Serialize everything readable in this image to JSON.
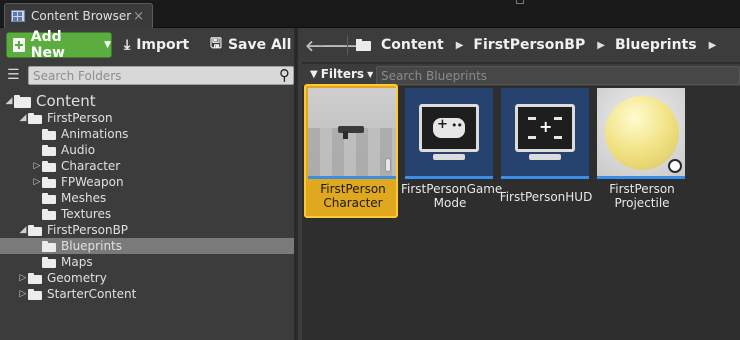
{
  "window": {
    "tab_title": "Content Browser",
    "tab_close": "×"
  },
  "toolbar": {
    "add_new_label": "Add New",
    "import_label": "Import",
    "save_all_label": "Save All"
  },
  "folder_search": {
    "placeholder": "Search Folders"
  },
  "tree": {
    "items": [
      {
        "label": "Content",
        "level": 0,
        "arrow": "◢",
        "selected": false
      },
      {
        "label": "FirstPerson",
        "level": 1,
        "arrow": "◢",
        "selected": false
      },
      {
        "label": "Animations",
        "level": 2,
        "arrow": "",
        "selected": false
      },
      {
        "label": "Audio",
        "level": 2,
        "arrow": "",
        "selected": false
      },
      {
        "label": "Character",
        "level": 2,
        "arrow": "▷",
        "selected": false
      },
      {
        "label": "FPWeapon",
        "level": 2,
        "arrow": "▷",
        "selected": false
      },
      {
        "label": "Meshes",
        "level": 2,
        "arrow": "",
        "selected": false
      },
      {
        "label": "Textures",
        "level": 2,
        "arrow": "",
        "selected": false
      },
      {
        "label": "FirstPersonBP",
        "level": 1,
        "arrow": "◢",
        "selected": false
      },
      {
        "label": "Blueprints",
        "level": 2,
        "arrow": "",
        "selected": true
      },
      {
        "label": "Maps",
        "level": 2,
        "arrow": "",
        "selected": false
      },
      {
        "label": "Geometry",
        "level": 1,
        "arrow": "▷",
        "selected": false
      },
      {
        "label": "StarterContent",
        "level": 1,
        "arrow": "▷",
        "selected": false
      }
    ]
  },
  "breadcrumb": {
    "items": [
      "Content",
      "FirstPersonBP",
      "Blueprints"
    ]
  },
  "asset_filter": {
    "filters_label": "Filters",
    "search_placeholder": "Search Blueprints"
  },
  "assets": [
    {
      "name_line1": "FirstPerson",
      "name_line2": "Character",
      "selected": true,
      "thumbnail": "character-icon"
    },
    {
      "name_line1": "FirstPersonGame",
      "name_line2": "Mode",
      "selected": false,
      "thumbnail": "gamepad-icon"
    },
    {
      "name_line1": "FirstPersonHUD",
      "name_line2": "",
      "selected": false,
      "thumbnail": "hud-icon"
    },
    {
      "name_line1": "FirstPerson",
      "name_line2": "Projectile",
      "selected": false,
      "thumbnail": "sphere-icon"
    }
  ],
  "colors": {
    "add_new_green": "#5cad3f",
    "selection_gold": "#e0a81e",
    "blueprint_type_bar": "#3a8ee6",
    "panel_bg": "#3c3c3c",
    "asset_area_bg": "#2e2e2e"
  }
}
